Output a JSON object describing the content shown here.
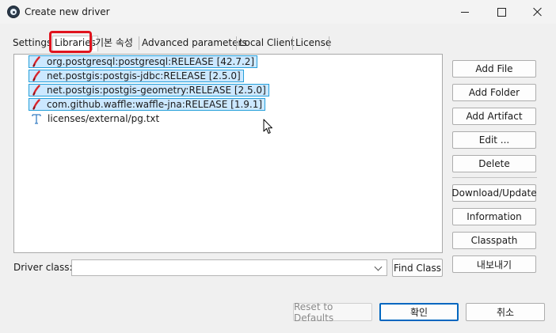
{
  "window": {
    "title": "Create new driver"
  },
  "tabs": [
    {
      "label": "Settings",
      "active": false
    },
    {
      "label": "Libraries",
      "active": true
    },
    {
      "label": "기본 속성",
      "active": false
    },
    {
      "label": "Advanced parameters",
      "active": false
    },
    {
      "label": "Local Client",
      "active": false
    },
    {
      "label": "License",
      "active": false
    }
  ],
  "libraries": [
    {
      "label": "org.postgresql:postgresql:RELEASE [42.7.2]",
      "icon": "jar-icon",
      "selected": true
    },
    {
      "label": "net.postgis:postgis-jdbc:RELEASE [2.5.0]",
      "icon": "jar-icon",
      "selected": true
    },
    {
      "label": "net.postgis:postgis-geometry:RELEASE [2.5.0]",
      "icon": "jar-icon",
      "selected": true
    },
    {
      "label": "com.github.waffle:waffle-jna:RELEASE [1.9.1]",
      "icon": "jar-icon",
      "selected": true
    },
    {
      "label": "licenses/external/pg.txt",
      "icon": "text-file-icon",
      "selected": false
    }
  ],
  "side_buttons": {
    "add_file": "Add File",
    "add_folder": "Add Folder",
    "add_artifact": "Add Artifact",
    "edit": "Edit ...",
    "delete": "Delete",
    "download_update": "Download/Update",
    "information": "Information",
    "classpath": "Classpath",
    "export": "내보내기"
  },
  "driver_class": {
    "label": "Driver class:",
    "value": "",
    "find_button": "Find Class"
  },
  "footer": {
    "reset": "Reset to Defaults",
    "ok": "확인",
    "cancel": "취소"
  },
  "colors": {
    "selection_bg": "#cce8ff",
    "selection_border": "#26a0da",
    "highlight_box": "#e0141e",
    "default_button_border": "#0067c0",
    "jar_icon": "#d8262d"
  }
}
